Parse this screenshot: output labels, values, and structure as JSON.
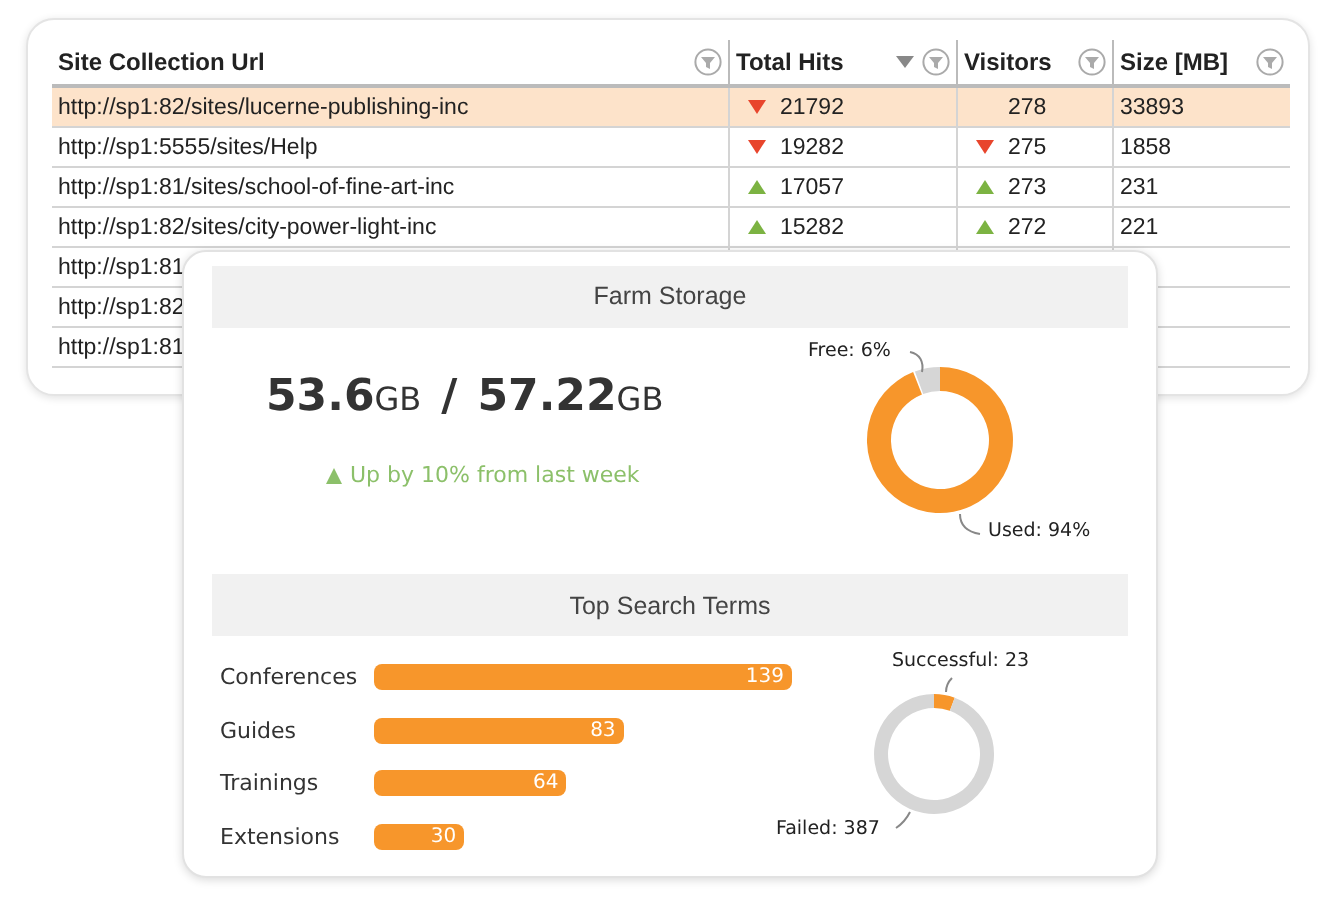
{
  "table": {
    "columns": [
      {
        "label": "Site Collection Url",
        "sorted": false
      },
      {
        "label": "Total Hits",
        "sorted": true
      },
      {
        "label": "Visitors",
        "sorted": false
      },
      {
        "label": "Size [MB]",
        "sorted": false
      }
    ],
    "rows": [
      {
        "selected": true,
        "cells": [
          {
            "text": "http://sp1:82/sites/lucerne-publishing-inc"
          },
          {
            "text": "21792",
            "kind": "falling"
          },
          {
            "text": "278"
          },
          {
            "text": "33893"
          }
        ]
      },
      {
        "selected": false,
        "cells": [
          {
            "text": "http://sp1:5555/sites/Help"
          },
          {
            "text": "19282",
            "kind": "falling"
          },
          {
            "text": "275",
            "kind": "falling"
          },
          {
            "text": "1858"
          }
        ]
      },
      {
        "selected": false,
        "cells": [
          {
            "text": "http://sp1:81/sites/school-of-fine-art-inc"
          },
          {
            "text": "17057",
            "kind": "rising"
          },
          {
            "text": "273",
            "kind": "rising"
          },
          {
            "text": "231"
          }
        ]
      },
      {
        "selected": false,
        "cells": [
          {
            "text": "http://sp1:82/sites/city-power-light-inc"
          },
          {
            "text": "15282",
            "kind": "rising"
          },
          {
            "text": "272",
            "kind": "rising"
          },
          {
            "text": "221"
          }
        ]
      },
      {
        "selected": false,
        "cells": [
          {
            "text": "http://sp1:81"
          }
        ]
      },
      {
        "selected": false,
        "cells": [
          {
            "text": "http://sp1:82"
          }
        ]
      },
      {
        "selected": false,
        "cells": [
          {
            "text": "http://sp1:81"
          }
        ]
      }
    ]
  },
  "farm_storage": {
    "title": "Farm Storage",
    "used": "53.6",
    "used_unit": "GB",
    "separator": "/",
    "total": "57.22",
    "total_unit": "GB",
    "trend": {
      "kind": "rising",
      "text": "Up by 10% from last week"
    },
    "chart_data": {
      "type": "donut",
      "values": [
        94,
        6
      ],
      "value_labels": [
        "Used: 94%",
        "Free: 6%"
      ]
    }
  },
  "top_search_terms": {
    "title": "Top Search Terms",
    "chart_data": {
      "type": "bar",
      "orientation": "horizontal",
      "categories": [
        "Conferences",
        "Guides",
        "Trainings",
        "Extensions"
      ],
      "values": [
        139,
        83,
        64,
        30
      ],
      "data_labels": true
    },
    "outcome_chart": {
      "chart_data": {
        "type": "donut",
        "values": [
          23,
          387
        ],
        "value_labels": [
          "Successful: 23",
          "Failed: 387"
        ]
      }
    }
  }
}
